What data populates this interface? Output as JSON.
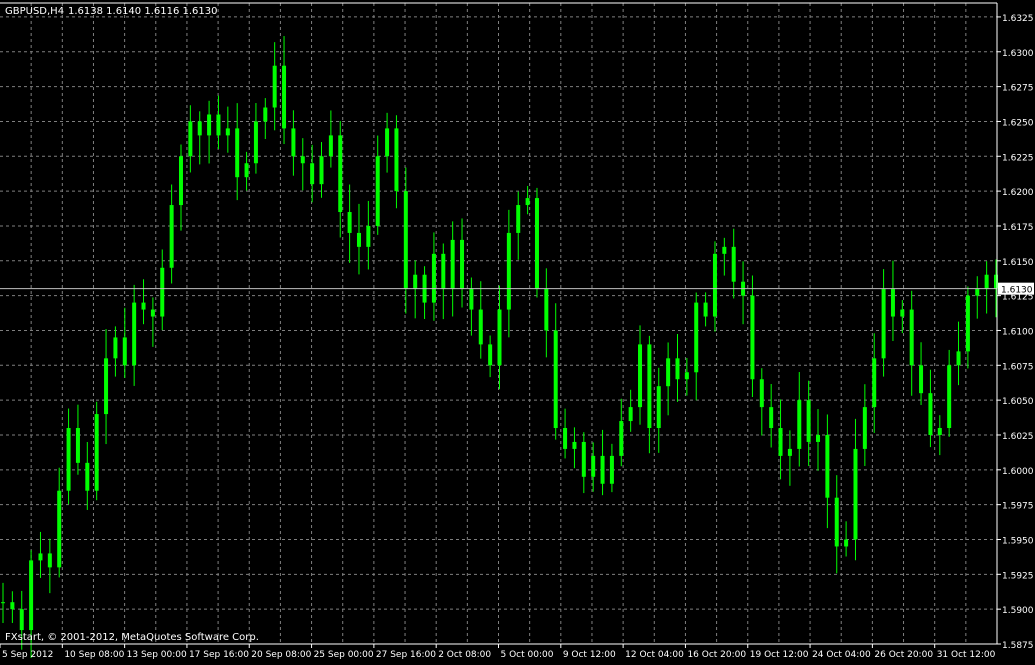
{
  "header": {
    "symbol_label": "GBPUSD,H4",
    "ohlc_label": "1.6138 1.6140 1.6116 1.6130"
  },
  "footer": {
    "copyright": "FXstart, © 2001-2012, MetaQuotes Software Corp."
  },
  "colors": {
    "background": "#000000",
    "grid": "#7f7f7f",
    "axis": "#ffffff",
    "candle": "#00ff00",
    "bid_line": "#c0c0c0"
  },
  "chart_data": {
    "type": "line",
    "title": "GBPUSD,H4",
    "xlabel": "",
    "ylabel": "",
    "ylim": [
      1.5875,
      1.6335
    ],
    "grid": true,
    "current_price": "1.6130",
    "y_ticks": [
      "1.6325",
      "1.6300",
      "1.6275",
      "1.6250",
      "1.6225",
      "1.6200",
      "1.6175",
      "1.6150",
      "1.6125",
      "1.6100",
      "1.6075",
      "1.6050",
      "1.6025",
      "1.6000",
      "1.5975",
      "1.5950",
      "1.5925",
      "1.5900",
      "1.5875"
    ],
    "x_ticks": [
      "5 Sep 2012",
      "10 Sep 08:00",
      "13 Sep 00:00",
      "17 Sep 16:00",
      "20 Sep 08:00",
      "25 Sep 00:00",
      "27 Sep 16:00",
      "2 Oct 08:00",
      "5 Oct 00:00",
      "9 Oct 12:00",
      "12 Oct 04:00",
      "16 Oct 20:00",
      "19 Oct 12:00",
      "24 Oct 04:00",
      "26 Oct 20:00",
      "31 Oct 12:00"
    ],
    "series": [
      {
        "values": [
          1.5905,
          1.59,
          1.5885,
          1.5935,
          1.594,
          1.593,
          1.5985,
          1.603,
          1.6005,
          1.5985,
          1.604,
          1.608,
          1.6095,
          1.6075,
          1.612,
          1.6115,
          1.611,
          1.6145,
          1.619,
          1.6225,
          1.625,
          1.624,
          1.6255,
          1.624,
          1.6245,
          1.621,
          1.622,
          1.625,
          1.626,
          1.629,
          1.6245,
          1.6225,
          1.622,
          1.6205,
          1.6225,
          1.624,
          1.6185,
          1.617,
          1.616,
          1.6175,
          1.6225,
          1.6245,
          1.62,
          1.613,
          1.614,
          1.612,
          1.6155,
          1.613,
          1.6165,
          1.613,
          1.6115,
          1.609,
          1.6075,
          1.6115,
          1.617,
          1.619,
          1.6195,
          1.613,
          1.61,
          1.603,
          1.6015,
          1.602,
          1.5995,
          1.601,
          1.599,
          1.601,
          1.6035,
          1.6045,
          1.609,
          1.603,
          1.606,
          1.608,
          1.6065,
          1.607,
          1.612,
          1.611,
          1.6155,
          1.616,
          1.6135,
          1.6125,
          1.6065,
          1.6045,
          1.603,
          1.601,
          1.6015,
          1.605,
          1.602,
          1.6025,
          1.598,
          1.5945,
          1.595,
          1.6015,
          1.6045,
          1.608,
          1.613,
          1.611,
          1.6115,
          1.6075,
          1.6055,
          1.6025,
          1.603,
          1.6075,
          1.6085,
          1.6125,
          1.613,
          1.614,
          1.613
        ]
      }
    ]
  }
}
